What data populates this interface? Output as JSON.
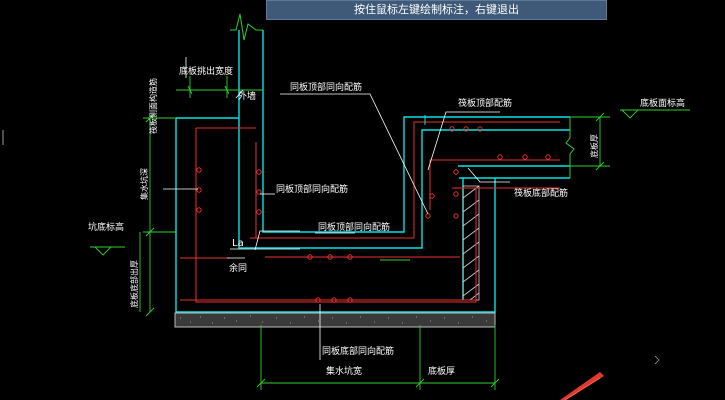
{
  "prompt": {
    "text": "按住鼠标左键绘制标注，右键退出"
  },
  "labels": {
    "floor_overhang_width": "底板挑出宽度",
    "outer_wall": "外墙",
    "floor_side_rebar": "筏板侧面构造筋",
    "same_top_rebar_1": "同板顶部同向配筋",
    "raft_top_rebar": "筏板顶部配筋",
    "raft_surface_elev": "底板面标高",
    "floor_thickness": "底板厚",
    "pit_depth": "集水坑深",
    "same_top_rebar_2": "同板顶部同向配筋",
    "raft_bottom_rebar": "筏板底部配筋",
    "pit_bottom_elev": "坑底标高",
    "same_top_rebar_3": "同板顶部同向配筋",
    "la": "La",
    "remainder": "余同",
    "bottom_thickness": "底板底部出厚",
    "same_bottom_rebar": "同板底部同向配筋",
    "pit_width": "集水坑宽",
    "floor_thickness_bottom": "底板厚"
  },
  "colors": {
    "background": "#000000",
    "concrete": "#00e5e5",
    "rebar": "#e83030",
    "dimension": "#2ed02e",
    "leader": "#ffffff",
    "hatch": "#cfcfcf",
    "prompt_bg": "#3f5a78"
  }
}
